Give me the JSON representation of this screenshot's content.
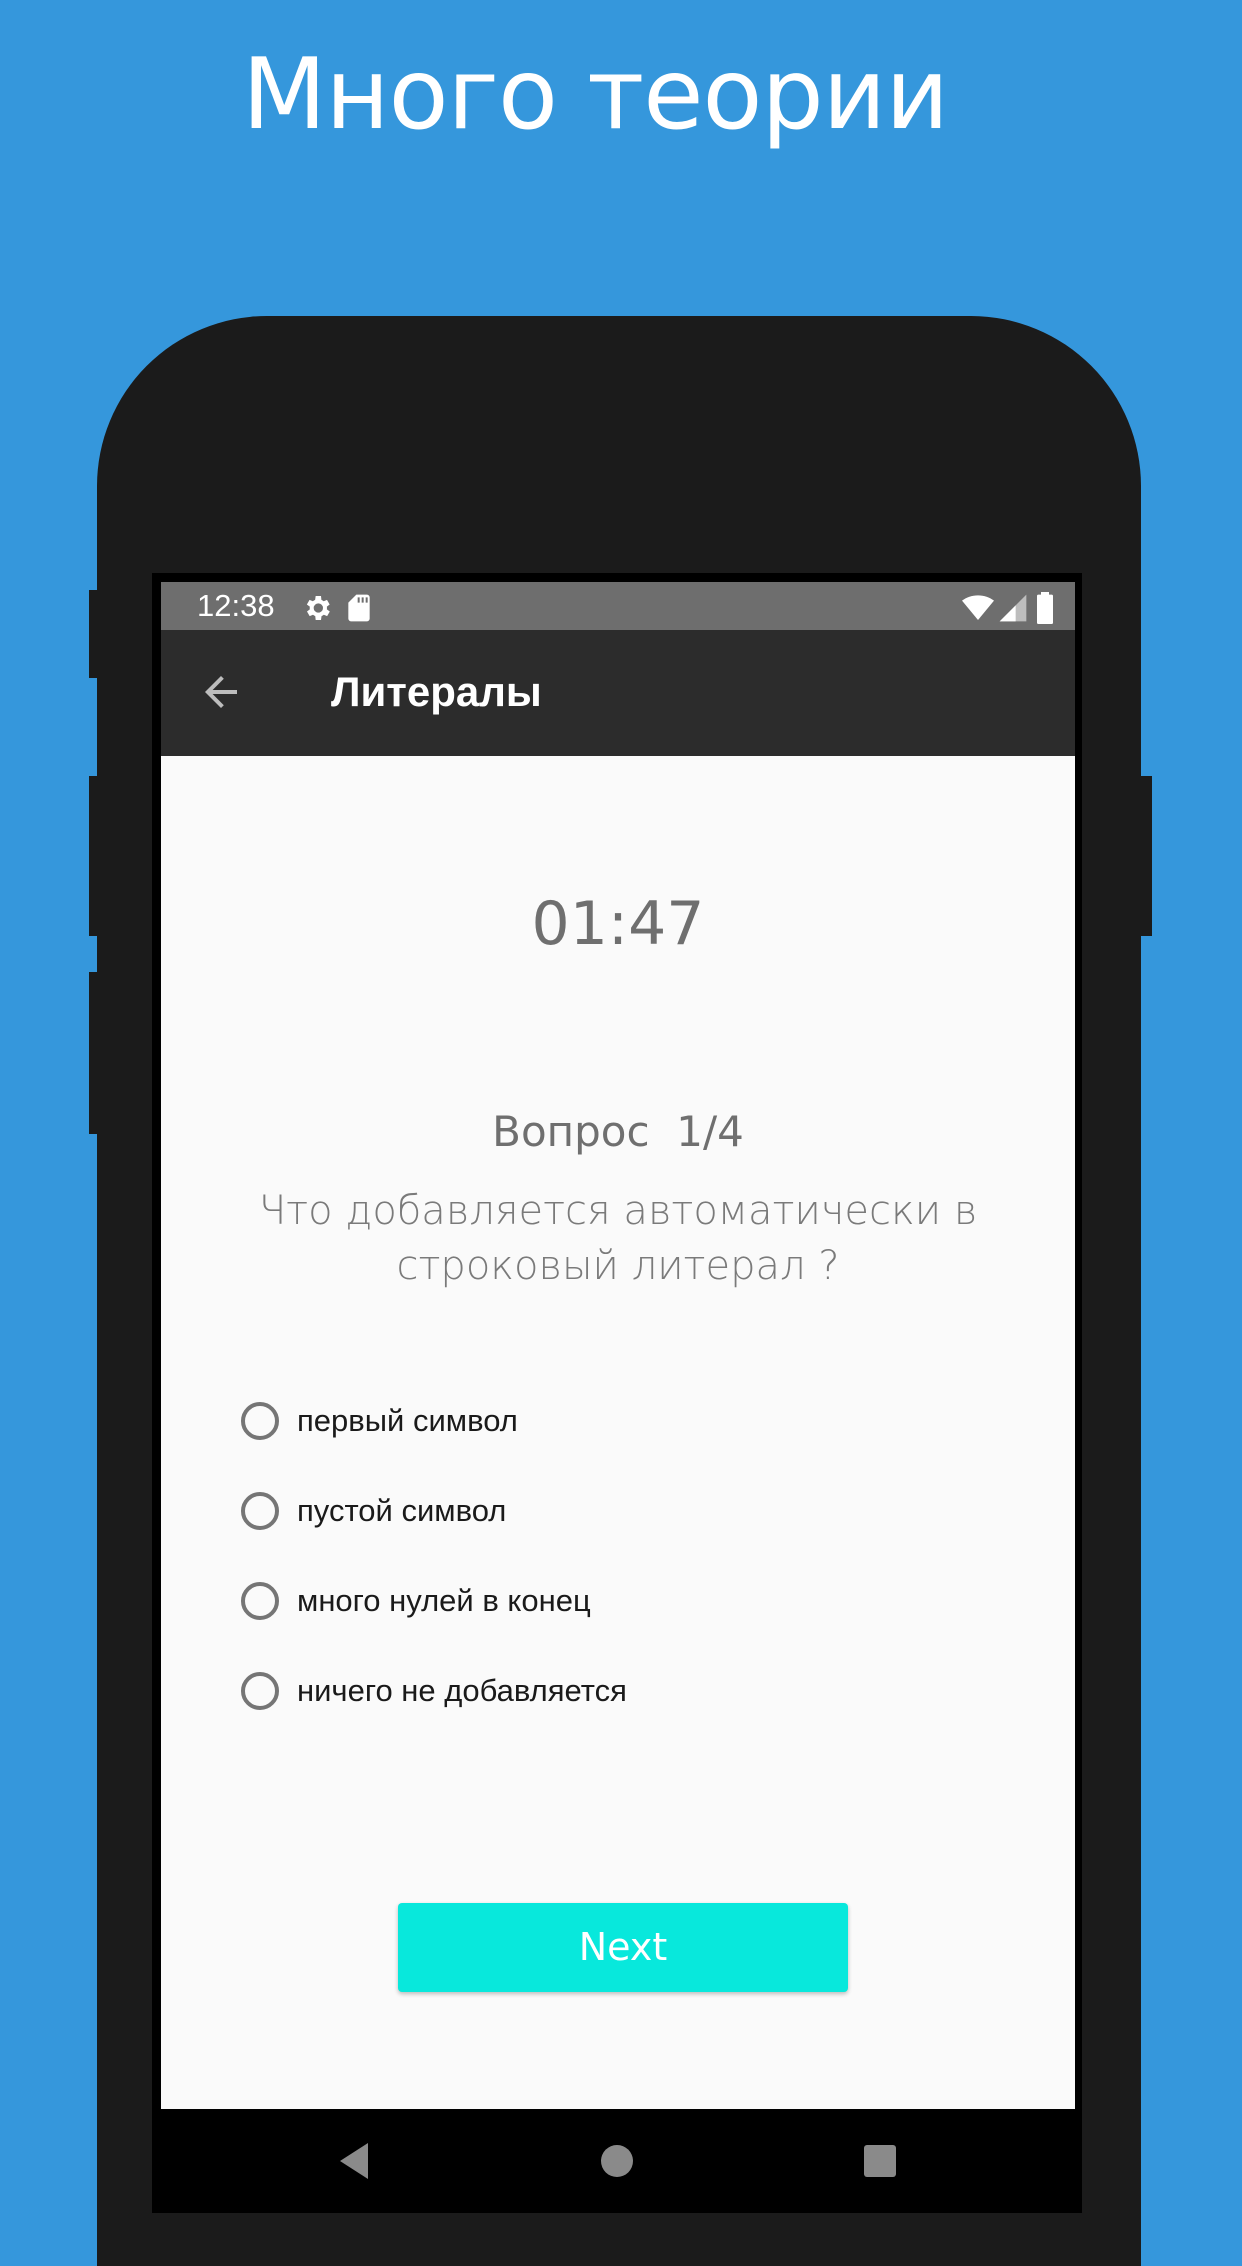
{
  "promo": {
    "headline": "Много теории",
    "background_color": "#3597dc"
  },
  "status_bar": {
    "time": "12:38",
    "left_icons": [
      "gear-icon",
      "sd-card-icon"
    ],
    "right_icons": [
      "wifi-icon",
      "cell-signal-icon",
      "battery-icon"
    ]
  },
  "app_bar": {
    "back_icon": "arrow-left-icon",
    "title": "Литералы"
  },
  "quiz": {
    "timer": "01:47",
    "question_number": "Вопрос  1/4",
    "question_text": "Что добавляется автоматически в строковый литерал ?",
    "options": [
      {
        "label": "первый символ",
        "selected": false
      },
      {
        "label": "пустой символ",
        "selected": false
      },
      {
        "label": "много нулей в конец",
        "selected": false
      },
      {
        "label": "ничего не добавляется",
        "selected": false
      }
    ],
    "next_label": "Next",
    "accent_color": "#08e8dc"
  },
  "nav_bar": {
    "buttons": [
      "back-triangle-icon",
      "home-circle-icon",
      "recents-square-icon"
    ]
  }
}
